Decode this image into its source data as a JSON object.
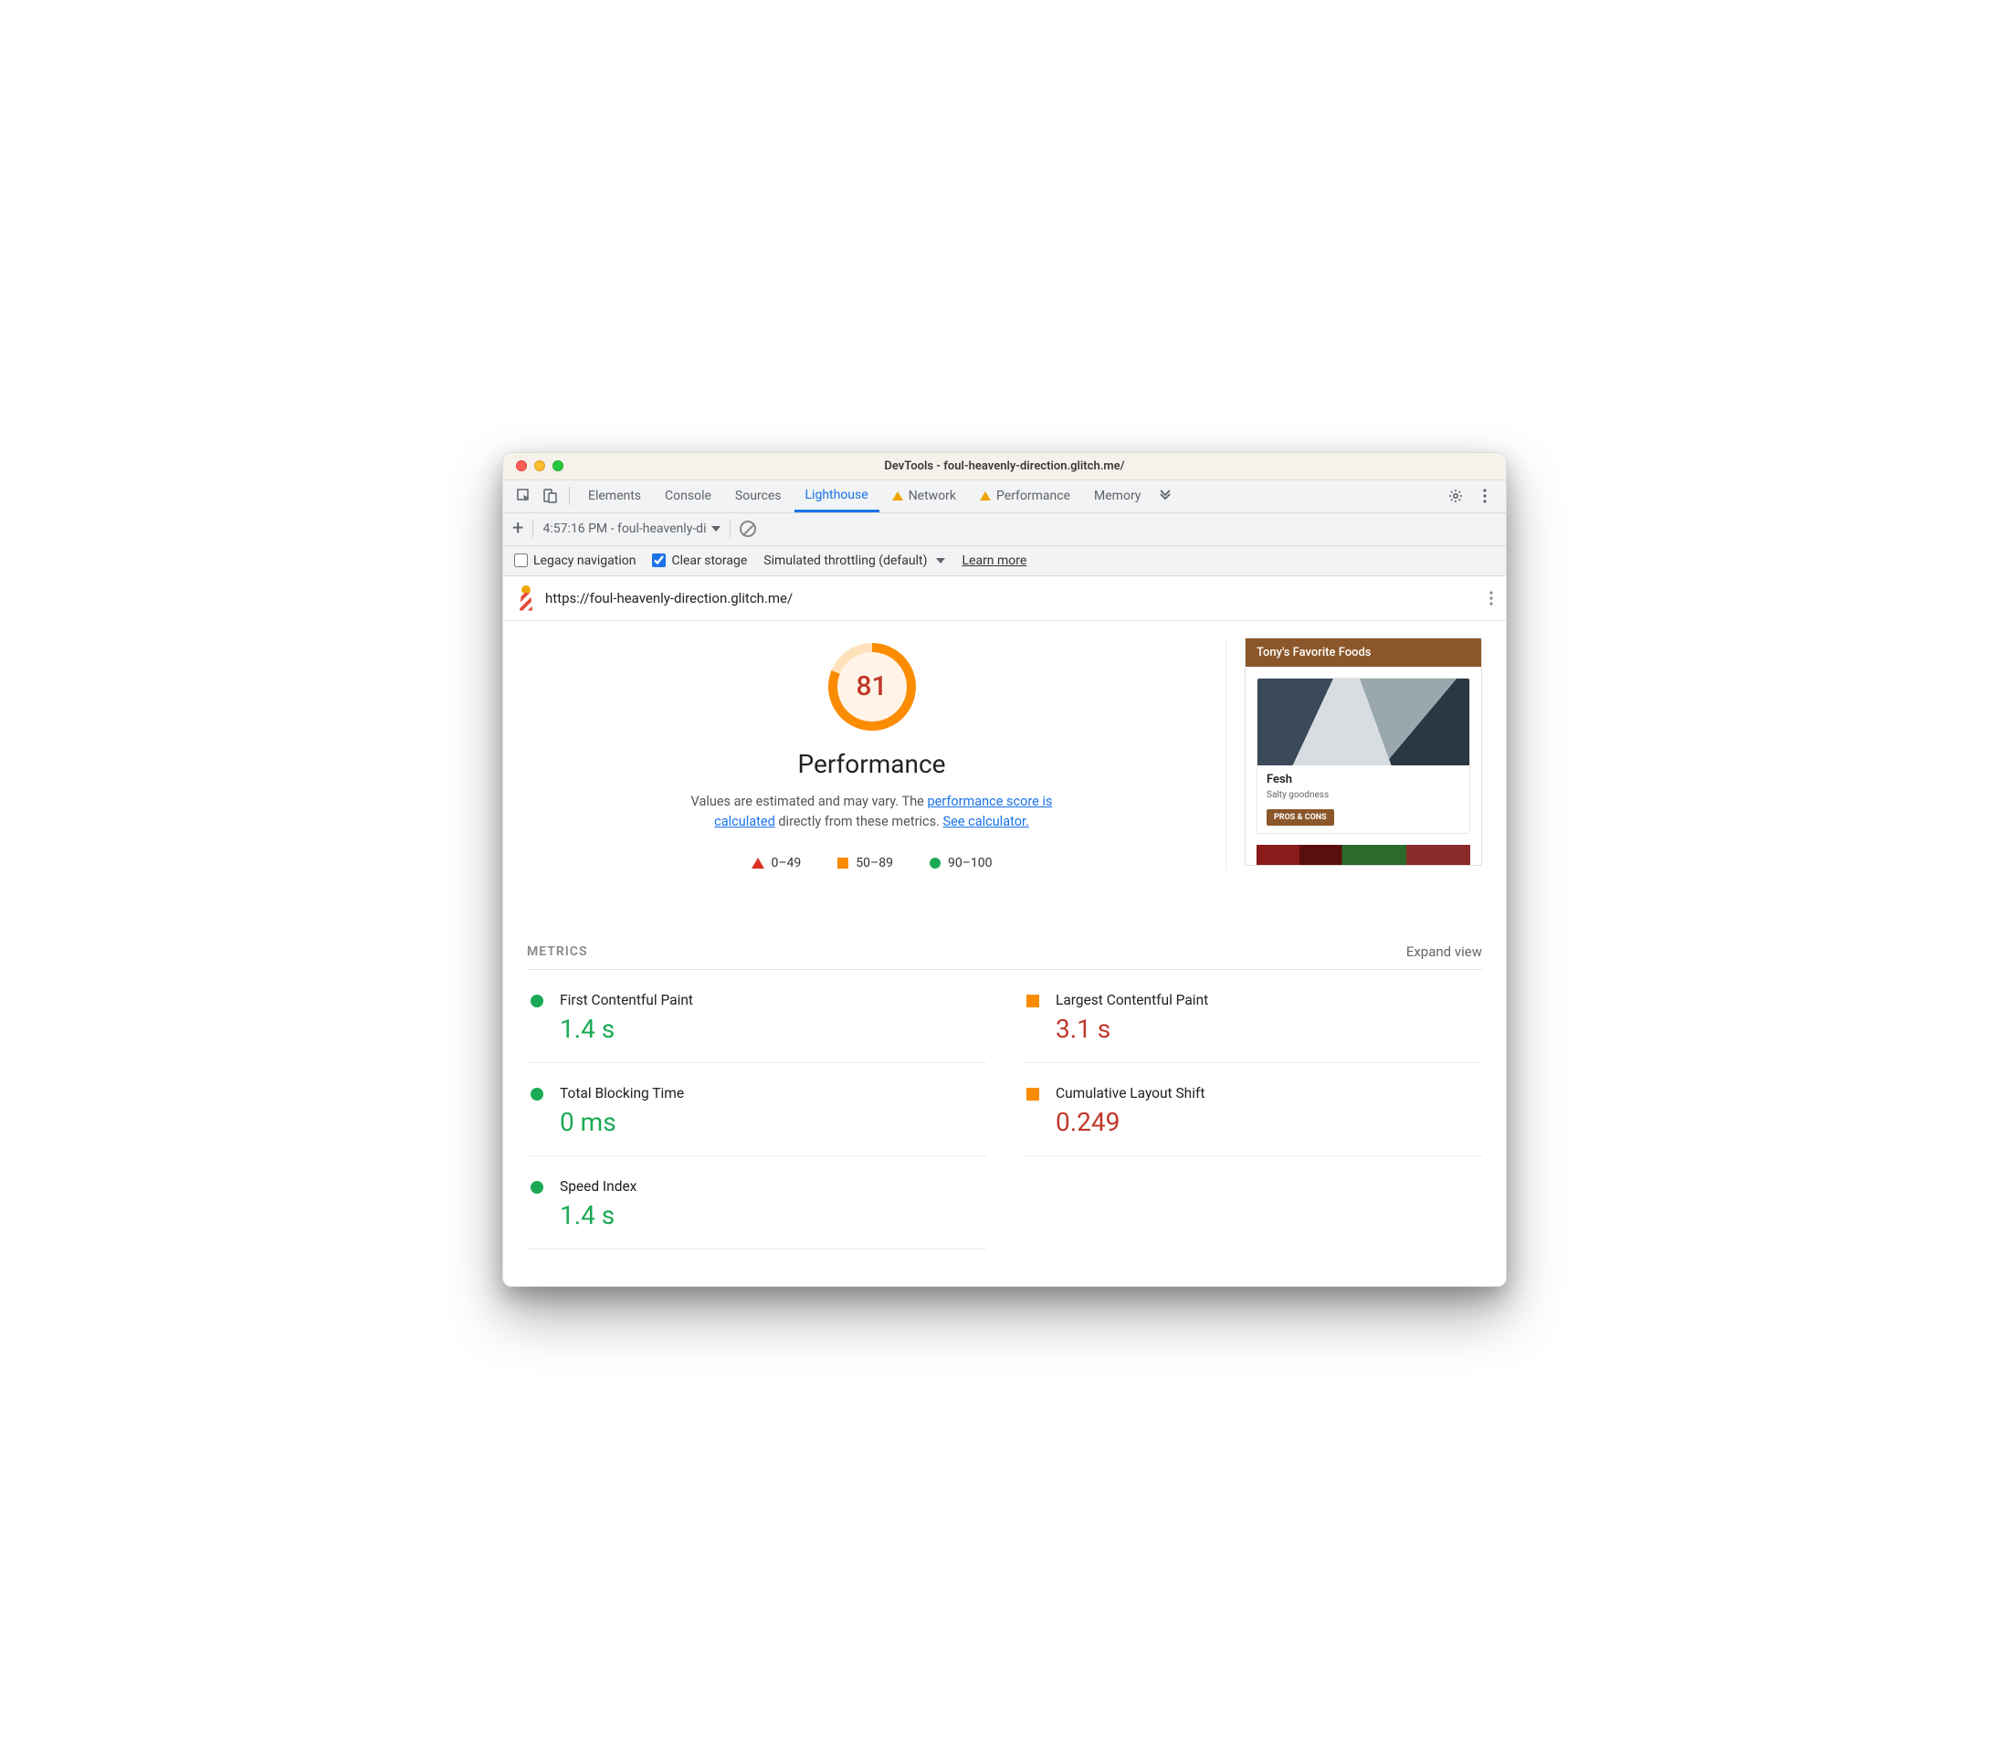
{
  "window": {
    "title": "DevTools - foul-heavenly-direction.glitch.me/"
  },
  "tabs": {
    "items": [
      "Elements",
      "Console",
      "Sources",
      "Lighthouse",
      "Network",
      "Performance",
      "Memory"
    ],
    "active": "Lighthouse"
  },
  "toolbar": {
    "report_label": "4:57:16 PM - foul-heavenly-di"
  },
  "settings": {
    "legacy_label": "Legacy navigation",
    "clear_label": "Clear storage",
    "throttle_label": "Simulated throttling (default)",
    "learn_more": "Learn more"
  },
  "url": "https://foul-heavenly-direction.glitch.me/",
  "hero": {
    "score": "81",
    "title": "Performance",
    "desc_pre": "Values are estimated and may vary. The ",
    "desc_link1": "performance score is calculated",
    "desc_mid": " directly from these metrics. ",
    "desc_link2": "See calculator.",
    "legend": {
      "low": "0–49",
      "mid": "50–89",
      "high": "90–100"
    }
  },
  "preview": {
    "header": "Tony's Favorite Foods",
    "card_title": "Fesh",
    "card_sub": "Salty goodness",
    "card_btn": "PROS & CONS"
  },
  "metrics": {
    "title": "METRICS",
    "expand": "Expand view",
    "items": [
      {
        "name": "First Contentful Paint",
        "value": "1.4 s",
        "status": "green"
      },
      {
        "name": "Largest Contentful Paint",
        "value": "3.1 s",
        "status": "orange"
      },
      {
        "name": "Total Blocking Time",
        "value": "0 ms",
        "status": "green"
      },
      {
        "name": "Cumulative Layout Shift",
        "value": "0.249",
        "status": "orange"
      },
      {
        "name": "Speed Index",
        "value": "1.4 s",
        "status": "green"
      }
    ]
  }
}
